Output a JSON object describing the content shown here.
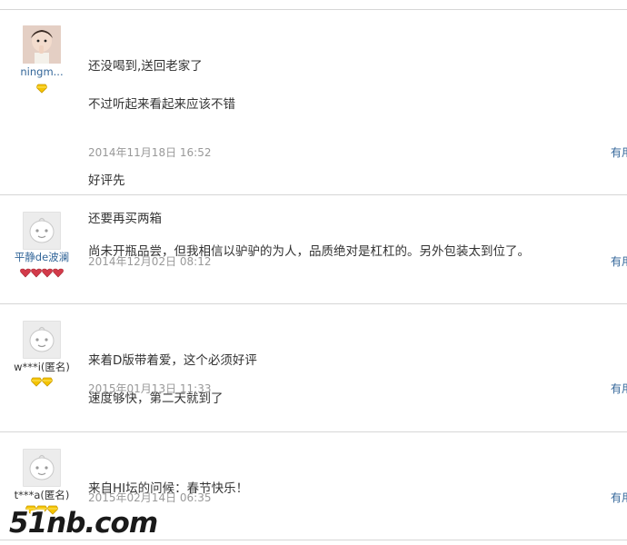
{
  "reviews": [
    {
      "username": "ningm...",
      "lines": [
        "还没喝到,送回老家了",
        "不过听起来看起来应该不错",
        "",
        "好评先",
        "还要再买两箱"
      ],
      "date": "2014年11月18日 16:52",
      "useful_label": "有用",
      "badge": {
        "type": "diamond-yellow",
        "count": 1
      }
    },
    {
      "username": "平静de波澜",
      "lines": [
        "尚未开瓶品尝，但我相信以驴驴的为人，品质绝对是杠杠的。另外包装太到位了。"
      ],
      "date": "2014年12月02日 08:12",
      "useful_label": "有用",
      "badge": {
        "type": "heart-red",
        "count": 4
      }
    },
    {
      "username": "w***i(匿名)",
      "lines": [
        "来着D版带着爱，这个必须好评",
        "速度够快，第二天就到了"
      ],
      "date": "2015年01月13日 11:33",
      "useful_label": "有用",
      "badge": {
        "type": "diamond-yellow",
        "count": 2
      }
    },
    {
      "username": "t***a(匿名)",
      "lines": [
        "来自HI坛的问候：春节快乐！"
      ],
      "date": "2015年02月14日 06:35",
      "useful_label": "有用",
      "badge": {
        "type": "diamond-yellow",
        "count": 3
      }
    }
  ],
  "watermark": "51nb.com",
  "colors": {
    "username": "#336699",
    "date": "#999999",
    "badge_yellow": "#f5c400",
    "badge_red": "#d33b4a"
  }
}
